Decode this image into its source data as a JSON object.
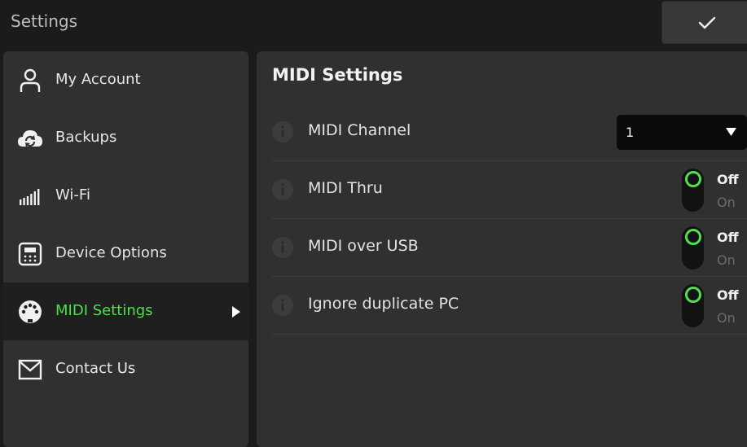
{
  "app": {
    "title": "Settings"
  },
  "colors": {
    "accent": "#4ee04e",
    "background": "#1b1b1b",
    "panel": "#303030"
  },
  "sidebar": {
    "items": [
      {
        "label": "My Account",
        "icon": "user-icon",
        "active": false
      },
      {
        "label": "Backups",
        "icon": "cloud-sync-icon",
        "active": false
      },
      {
        "label": "Wi-Fi",
        "icon": "signal-bars-icon",
        "active": false
      },
      {
        "label": "Device Options",
        "icon": "device-icon",
        "active": false
      },
      {
        "label": "MIDI Settings",
        "icon": "midi-connector-icon",
        "active": true
      },
      {
        "label": "Contact Us",
        "icon": "envelope-icon",
        "active": false
      }
    ]
  },
  "main": {
    "title": "MIDI Settings",
    "rows": [
      {
        "label": "MIDI Channel",
        "type": "select",
        "value": "1"
      },
      {
        "label": "MIDI Thru",
        "type": "toggle",
        "off_label": "Off",
        "on_label": "On",
        "state": "Off"
      },
      {
        "label": "MIDI over USB",
        "type": "toggle",
        "off_label": "Off",
        "on_label": "On",
        "state": "Off"
      },
      {
        "label": "Ignore duplicate PC",
        "type": "toggle",
        "off_label": "Off",
        "on_label": "On",
        "state": "Off"
      }
    ]
  }
}
